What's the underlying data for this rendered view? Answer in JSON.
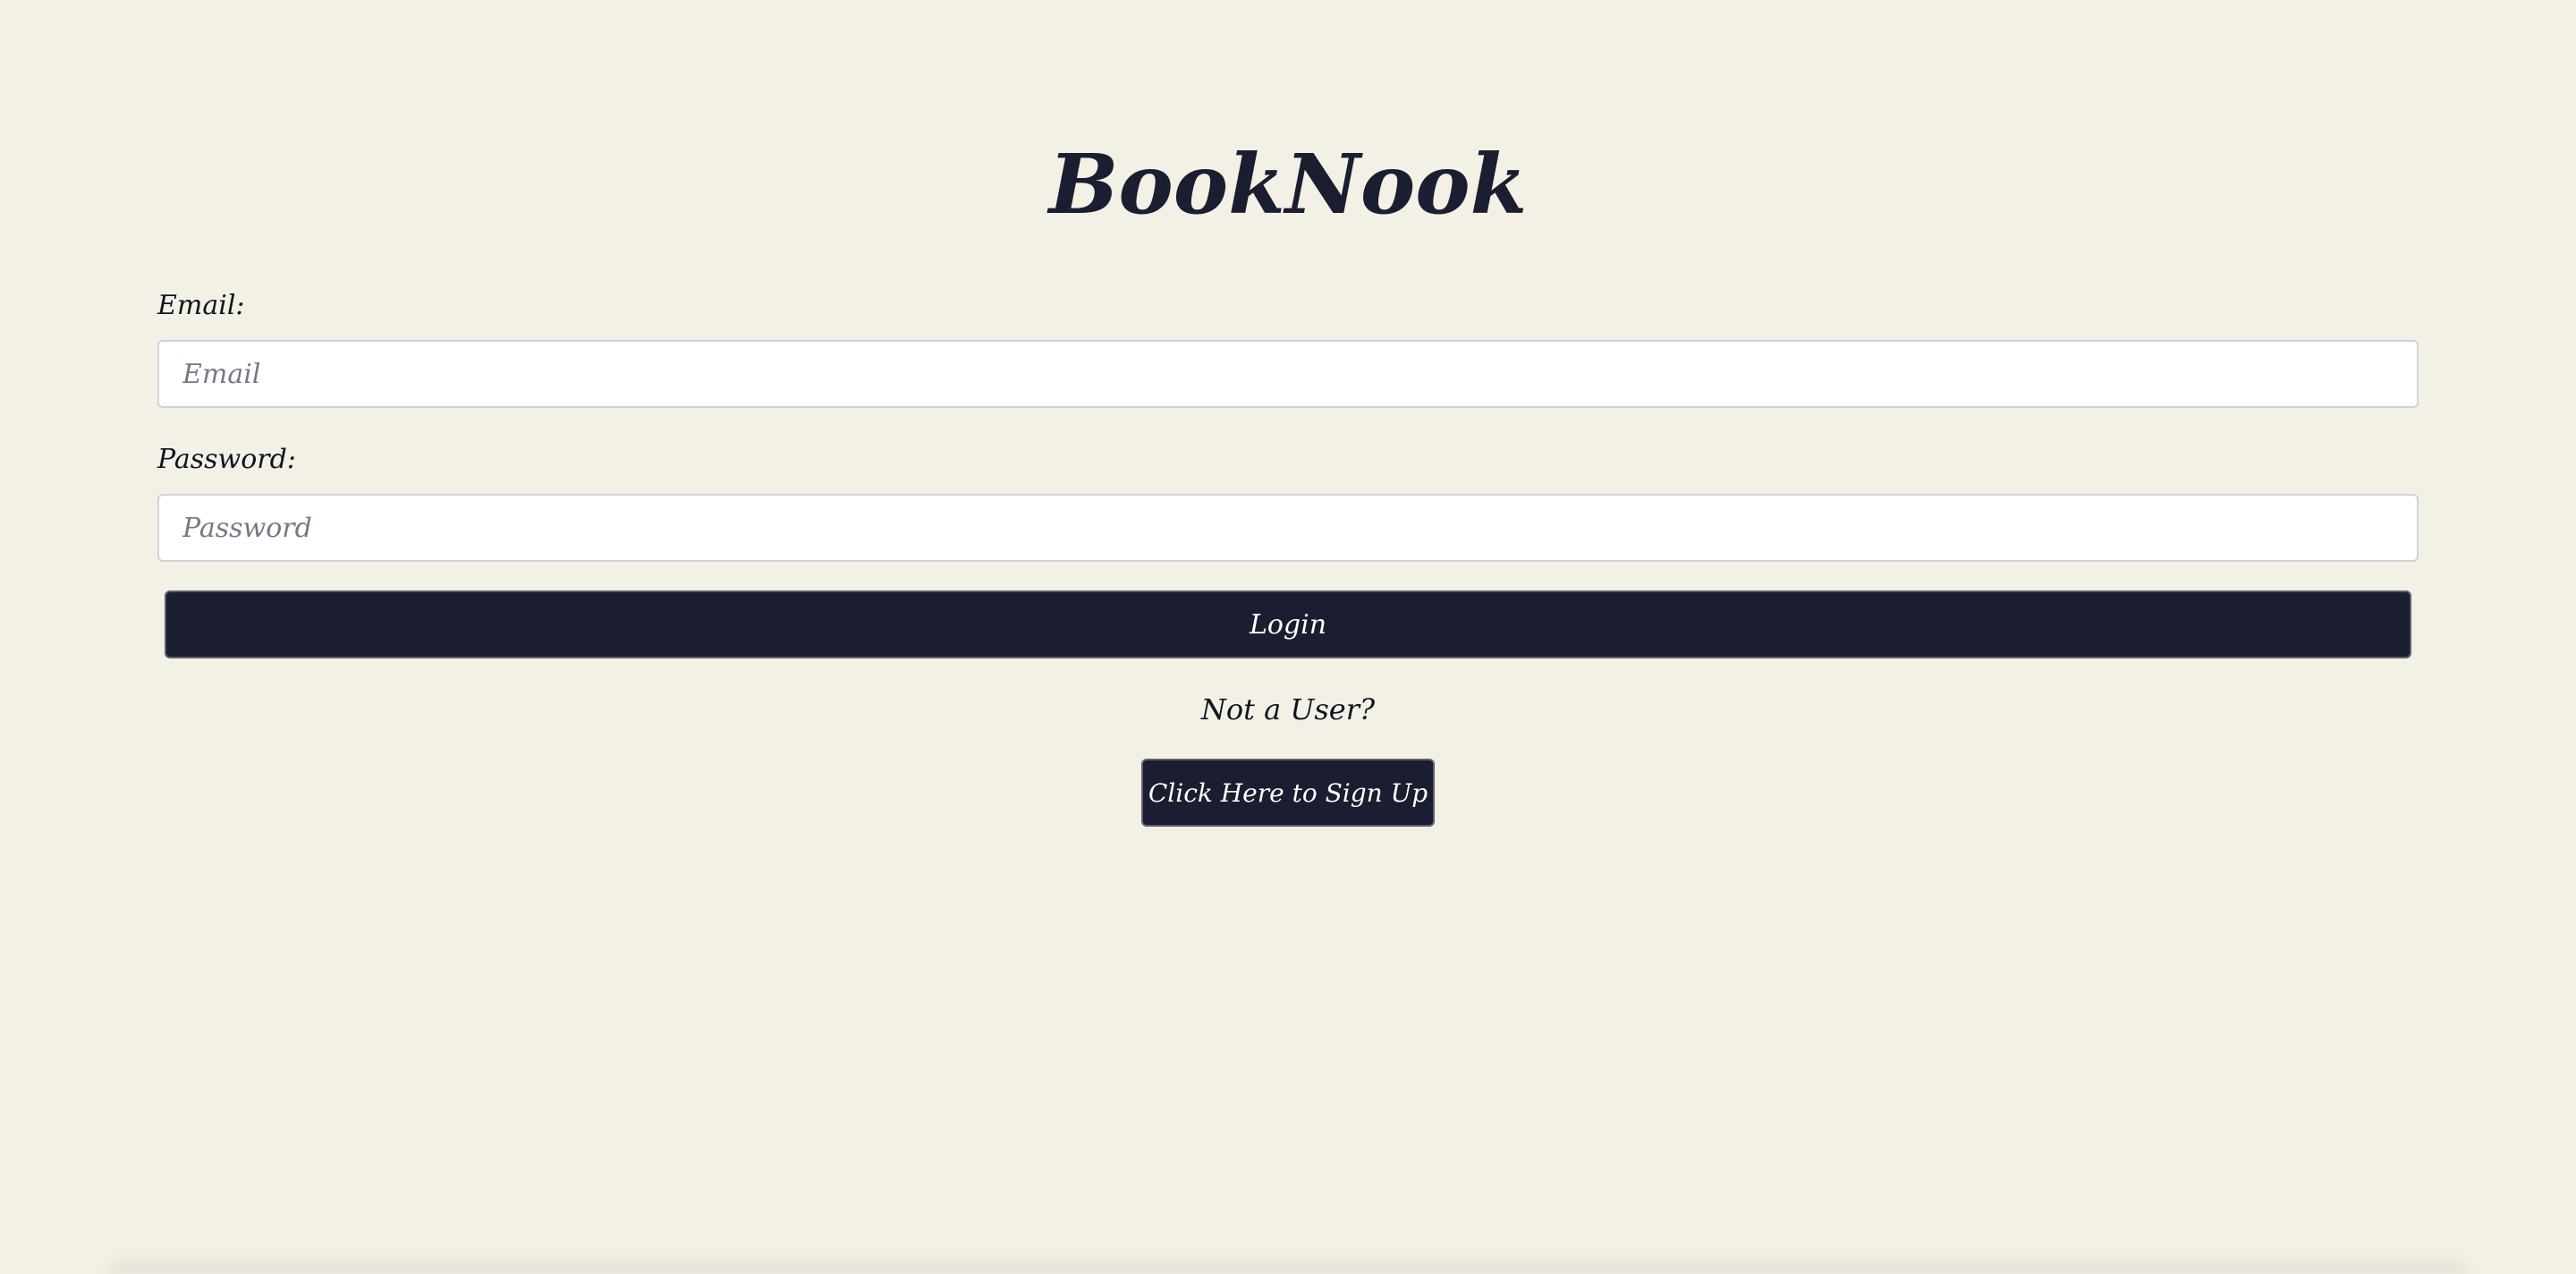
{
  "app": {
    "title": "BookNook"
  },
  "login_form": {
    "email_label": "Email:",
    "email_placeholder": "Email",
    "email_value": "",
    "password_label": "Password:",
    "password_placeholder": "Password",
    "password_value": "",
    "login_button_label": "Login"
  },
  "signup": {
    "prompt": "Not a User?",
    "button_label": "Click Here to Sign Up"
  },
  "colors": {
    "background": "#f3f1e6",
    "primary": "#1a1e30",
    "button_text": "#ffffff",
    "input_border": "#cfd2d8",
    "placeholder": "#747a85"
  }
}
